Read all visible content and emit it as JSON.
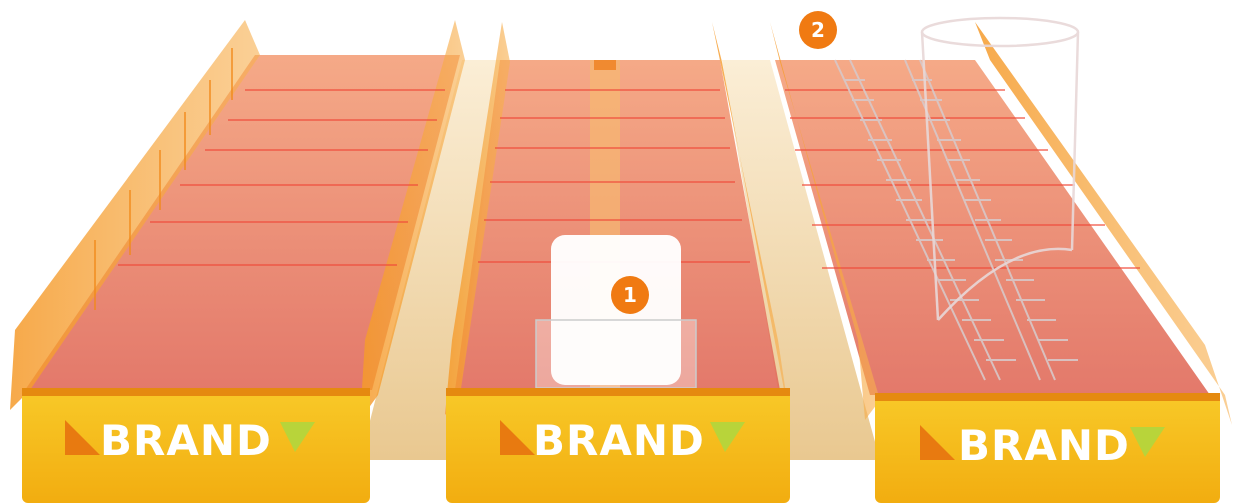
{
  "trays": [
    {
      "brand_label": "BRAND"
    },
    {
      "brand_label": "BRAND"
    },
    {
      "brand_label": "BRAND"
    }
  ],
  "callouts": [
    {
      "label": "1"
    },
    {
      "label": "2"
    }
  ],
  "colors": {
    "tray_tint": "#f08a4a",
    "divider": "#f5a623",
    "front_panel": "#f7c21a",
    "badge": "#f07a12",
    "gap_floor": "#eed5a0"
  }
}
